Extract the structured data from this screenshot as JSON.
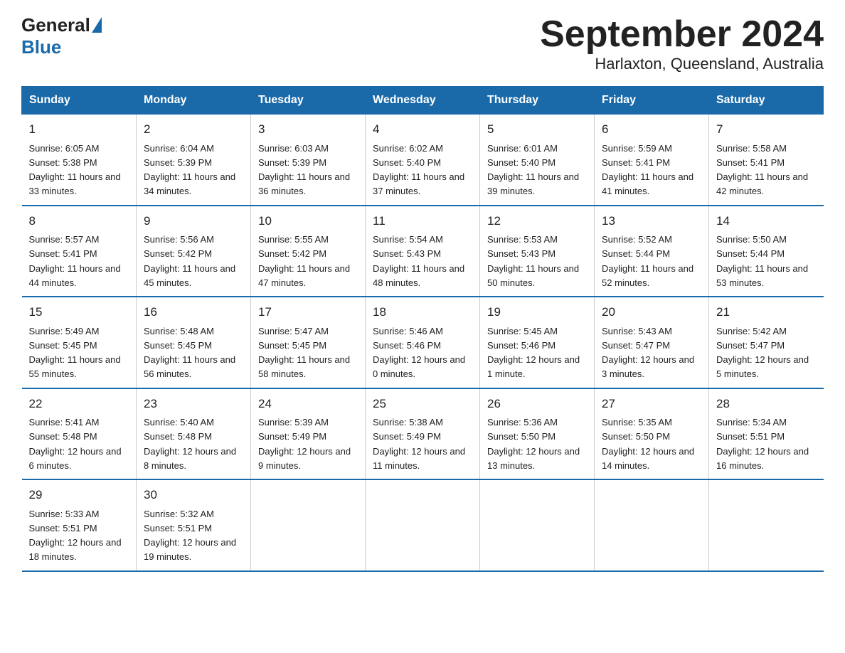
{
  "header": {
    "logo_general": "General",
    "logo_blue": "Blue",
    "title": "September 2024",
    "subtitle": "Harlaxton, Queensland, Australia"
  },
  "days_of_week": [
    "Sunday",
    "Monday",
    "Tuesday",
    "Wednesday",
    "Thursday",
    "Friday",
    "Saturday"
  ],
  "weeks": [
    [
      {
        "num": "1",
        "sunrise": "6:05 AM",
        "sunset": "5:38 PM",
        "daylight": "11 hours and 33 minutes."
      },
      {
        "num": "2",
        "sunrise": "6:04 AM",
        "sunset": "5:39 PM",
        "daylight": "11 hours and 34 minutes."
      },
      {
        "num": "3",
        "sunrise": "6:03 AM",
        "sunset": "5:39 PM",
        "daylight": "11 hours and 36 minutes."
      },
      {
        "num": "4",
        "sunrise": "6:02 AM",
        "sunset": "5:40 PM",
        "daylight": "11 hours and 37 minutes."
      },
      {
        "num": "5",
        "sunrise": "6:01 AM",
        "sunset": "5:40 PM",
        "daylight": "11 hours and 39 minutes."
      },
      {
        "num": "6",
        "sunrise": "5:59 AM",
        "sunset": "5:41 PM",
        "daylight": "11 hours and 41 minutes."
      },
      {
        "num": "7",
        "sunrise": "5:58 AM",
        "sunset": "5:41 PM",
        "daylight": "11 hours and 42 minutes."
      }
    ],
    [
      {
        "num": "8",
        "sunrise": "5:57 AM",
        "sunset": "5:41 PM",
        "daylight": "11 hours and 44 minutes."
      },
      {
        "num": "9",
        "sunrise": "5:56 AM",
        "sunset": "5:42 PM",
        "daylight": "11 hours and 45 minutes."
      },
      {
        "num": "10",
        "sunrise": "5:55 AM",
        "sunset": "5:42 PM",
        "daylight": "11 hours and 47 minutes."
      },
      {
        "num": "11",
        "sunrise": "5:54 AM",
        "sunset": "5:43 PM",
        "daylight": "11 hours and 48 minutes."
      },
      {
        "num": "12",
        "sunrise": "5:53 AM",
        "sunset": "5:43 PM",
        "daylight": "11 hours and 50 minutes."
      },
      {
        "num": "13",
        "sunrise": "5:52 AM",
        "sunset": "5:44 PM",
        "daylight": "11 hours and 52 minutes."
      },
      {
        "num": "14",
        "sunrise": "5:50 AM",
        "sunset": "5:44 PM",
        "daylight": "11 hours and 53 minutes."
      }
    ],
    [
      {
        "num": "15",
        "sunrise": "5:49 AM",
        "sunset": "5:45 PM",
        "daylight": "11 hours and 55 minutes."
      },
      {
        "num": "16",
        "sunrise": "5:48 AM",
        "sunset": "5:45 PM",
        "daylight": "11 hours and 56 minutes."
      },
      {
        "num": "17",
        "sunrise": "5:47 AM",
        "sunset": "5:45 PM",
        "daylight": "11 hours and 58 minutes."
      },
      {
        "num": "18",
        "sunrise": "5:46 AM",
        "sunset": "5:46 PM",
        "daylight": "12 hours and 0 minutes."
      },
      {
        "num": "19",
        "sunrise": "5:45 AM",
        "sunset": "5:46 PM",
        "daylight": "12 hours and 1 minute."
      },
      {
        "num": "20",
        "sunrise": "5:43 AM",
        "sunset": "5:47 PM",
        "daylight": "12 hours and 3 minutes."
      },
      {
        "num": "21",
        "sunrise": "5:42 AM",
        "sunset": "5:47 PM",
        "daylight": "12 hours and 5 minutes."
      }
    ],
    [
      {
        "num": "22",
        "sunrise": "5:41 AM",
        "sunset": "5:48 PM",
        "daylight": "12 hours and 6 minutes."
      },
      {
        "num": "23",
        "sunrise": "5:40 AM",
        "sunset": "5:48 PM",
        "daylight": "12 hours and 8 minutes."
      },
      {
        "num": "24",
        "sunrise": "5:39 AM",
        "sunset": "5:49 PM",
        "daylight": "12 hours and 9 minutes."
      },
      {
        "num": "25",
        "sunrise": "5:38 AM",
        "sunset": "5:49 PM",
        "daylight": "12 hours and 11 minutes."
      },
      {
        "num": "26",
        "sunrise": "5:36 AM",
        "sunset": "5:50 PM",
        "daylight": "12 hours and 13 minutes."
      },
      {
        "num": "27",
        "sunrise": "5:35 AM",
        "sunset": "5:50 PM",
        "daylight": "12 hours and 14 minutes."
      },
      {
        "num": "28",
        "sunrise": "5:34 AM",
        "sunset": "5:51 PM",
        "daylight": "12 hours and 16 minutes."
      }
    ],
    [
      {
        "num": "29",
        "sunrise": "5:33 AM",
        "sunset": "5:51 PM",
        "daylight": "12 hours and 18 minutes."
      },
      {
        "num": "30",
        "sunrise": "5:32 AM",
        "sunset": "5:51 PM",
        "daylight": "12 hours and 19 minutes."
      },
      null,
      null,
      null,
      null,
      null
    ]
  ]
}
